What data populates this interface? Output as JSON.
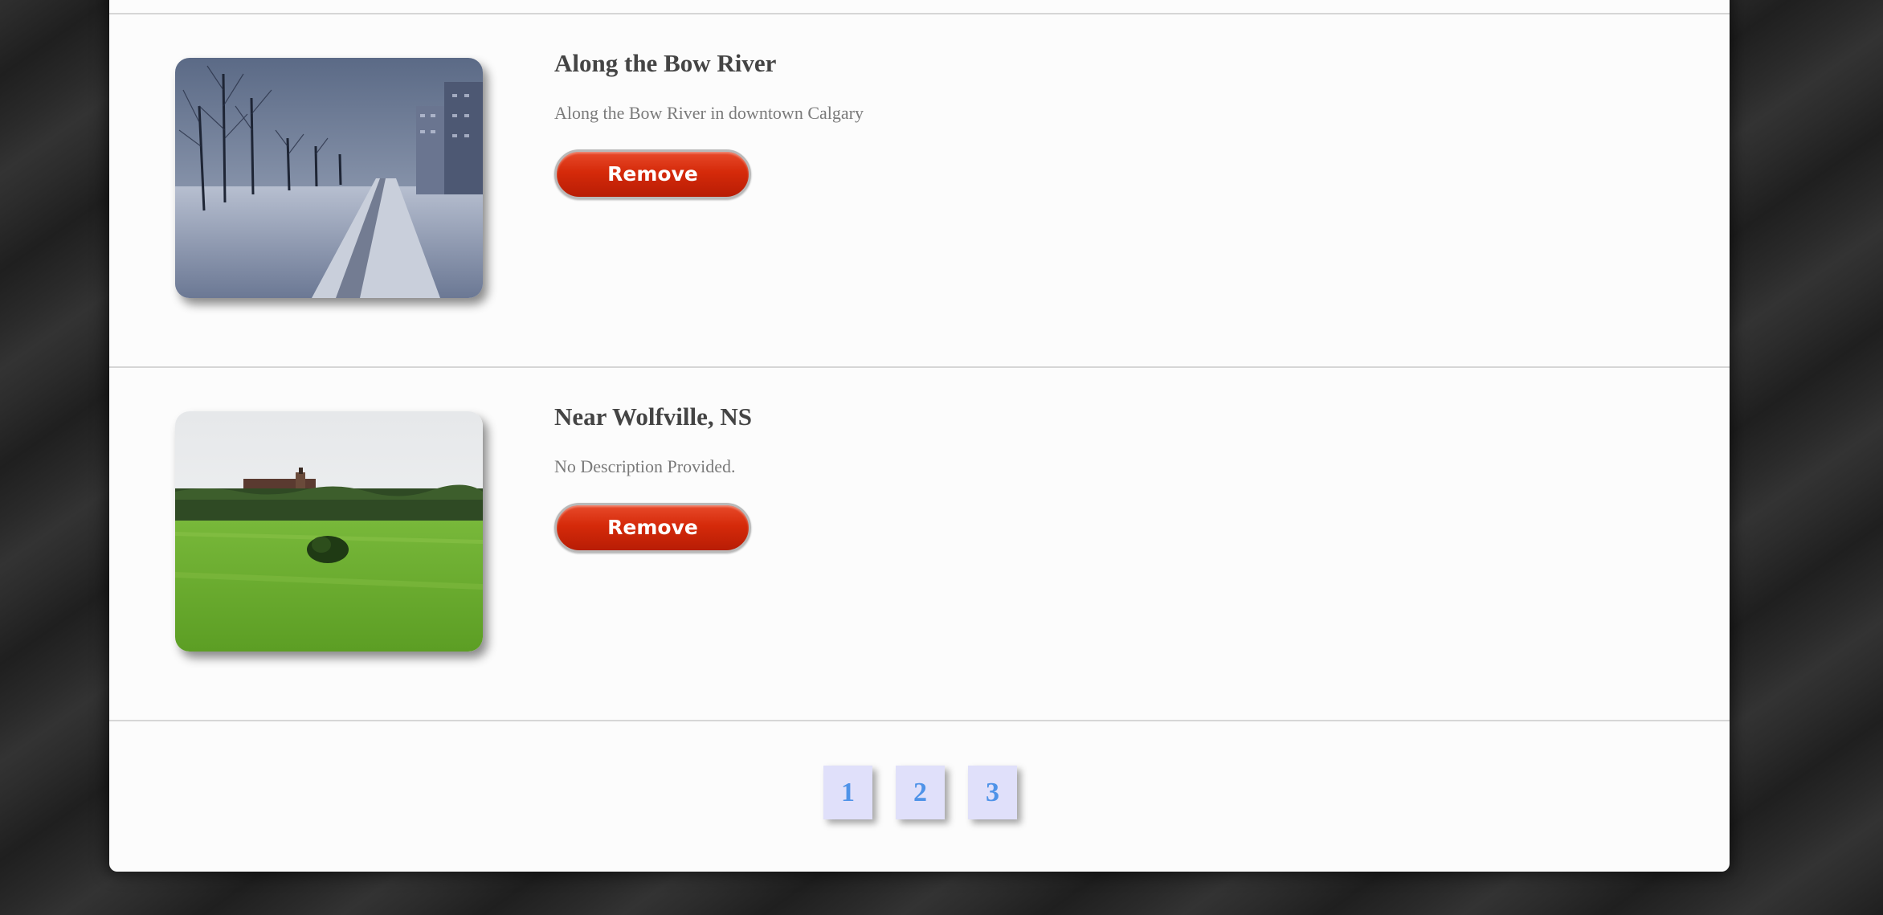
{
  "gallery": {
    "items": [
      {
        "title": "Along the Bow River",
        "description": "Along the Bow River in downtown Calgary",
        "remove_label": "Remove",
        "image_subject": "snowy-riverside-path"
      },
      {
        "title": "Near Wolfville, NS",
        "description": "No Description Provided.",
        "remove_label": "Remove",
        "image_subject": "green-field-farmhouse"
      }
    ]
  },
  "pagination": {
    "pages": [
      "1",
      "2",
      "3"
    ]
  },
  "colors": {
    "remove_button": "#d52a0a",
    "page_link_text": "#4f93e8",
    "page_link_bg": "#e0e0fa",
    "panel_bg": "#fcfcfc"
  }
}
